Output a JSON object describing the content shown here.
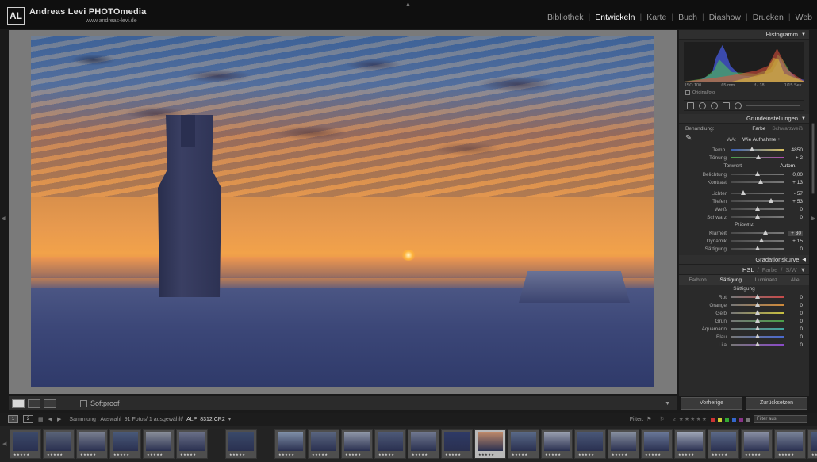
{
  "app": {
    "logo_text": "AL",
    "brand": "Andreas Levi PHOTOmedia",
    "brand_url": "www.andreas-levi.de",
    "modules": [
      {
        "label": "Bibliothek",
        "active": false
      },
      {
        "label": "Entwickeln",
        "active": true
      },
      {
        "label": "Karte",
        "active": false
      },
      {
        "label": "Buch",
        "active": false
      },
      {
        "label": "Diashow",
        "active": false
      },
      {
        "label": "Drucken",
        "active": false
      },
      {
        "label": "Web",
        "active": false
      }
    ]
  },
  "toolbar": {
    "softproof_label": "Softproof"
  },
  "histogram": {
    "title": "Histogramm",
    "iso": "ISO 100",
    "focal": "65 mm",
    "aperture": "f / 18",
    "shutter": "1/15 Sek.",
    "original_label": "Originalfoto"
  },
  "basic": {
    "title": "Grundeinstellungen",
    "treatment_label": "Behandlung:",
    "treatment_color": "Farbe",
    "treatment_bw": "Schwarzweiß",
    "wb_label": "WA:",
    "wb_value": "Wie Aufnahme ÷",
    "temp": {
      "label": "Temp.",
      "value": "4850",
      "pos": 0.4
    },
    "tint": {
      "label": "Tönung",
      "value": "+ 2",
      "pos": 0.52
    },
    "tone_label": "Tonwert",
    "auto_label": "Autom.",
    "exposure": {
      "label": "Belichtung",
      "value": "0,00",
      "pos": 0.5
    },
    "contrast": {
      "label": "Kontrast",
      "value": "+ 13",
      "pos": 0.56
    },
    "highlights": {
      "label": "Lichter",
      "value": "- 57",
      "pos": 0.22
    },
    "shadows": {
      "label": "Tiefen",
      "value": "+ 53",
      "pos": 0.76
    },
    "whites": {
      "label": "Weiß",
      "value": "0",
      "pos": 0.5
    },
    "blacks": {
      "label": "Schwarz",
      "value": "0",
      "pos": 0.5
    },
    "presence_label": "Präsenz",
    "clarity": {
      "label": "Klarheit",
      "value": "+ 30",
      "pos": 0.65
    },
    "vibrance": {
      "label": "Dynamik",
      "value": "+ 15",
      "pos": 0.57
    },
    "saturation": {
      "label": "Sättigung",
      "value": "0",
      "pos": 0.5
    }
  },
  "curve": {
    "title": "Gradationskurve"
  },
  "hsl": {
    "title_hsl": "HSL",
    "title_color": "Farbe",
    "title_sw": "S/W",
    "tabs": [
      "Farbton",
      "Sättigung",
      "Luminanz",
      "Alle"
    ],
    "active_tab": "Sättigung",
    "section_label": "Sättigung",
    "rows": [
      {
        "label": "Rot",
        "value": "0",
        "color": "#c84a4a"
      },
      {
        "label": "Orange",
        "value": "0",
        "color": "#d08a3a"
      },
      {
        "label": "Gelb",
        "value": "0",
        "color": "#c8c040"
      },
      {
        "label": "Grün",
        "value": "0",
        "color": "#4aa04a"
      },
      {
        "label": "Aquamarin",
        "value": "0",
        "color": "#40a8a0"
      },
      {
        "label": "Blau",
        "value": "0",
        "color": "#4a6ad0"
      },
      {
        "label": "Lila",
        "value": "0",
        "color": "#8a4ac8"
      }
    ]
  },
  "panel_buttons": {
    "previous": "Vorherige",
    "reset": "Zurücksetzen"
  },
  "filmbar": {
    "page1": "1",
    "page2": "2",
    "collection_label": "Sammlung : Auswahl",
    "count_label": "91 Fotos/ 1 ausgewählt/",
    "filename": "ALP_8312.CR2",
    "filter_label": "Filter:",
    "filter_value": "Filter aus"
  },
  "colors": {
    "accent_active_module": "#ffffff",
    "panel_bg": "#2a2a2a",
    "canvas_bg": "#7a7a7a"
  }
}
